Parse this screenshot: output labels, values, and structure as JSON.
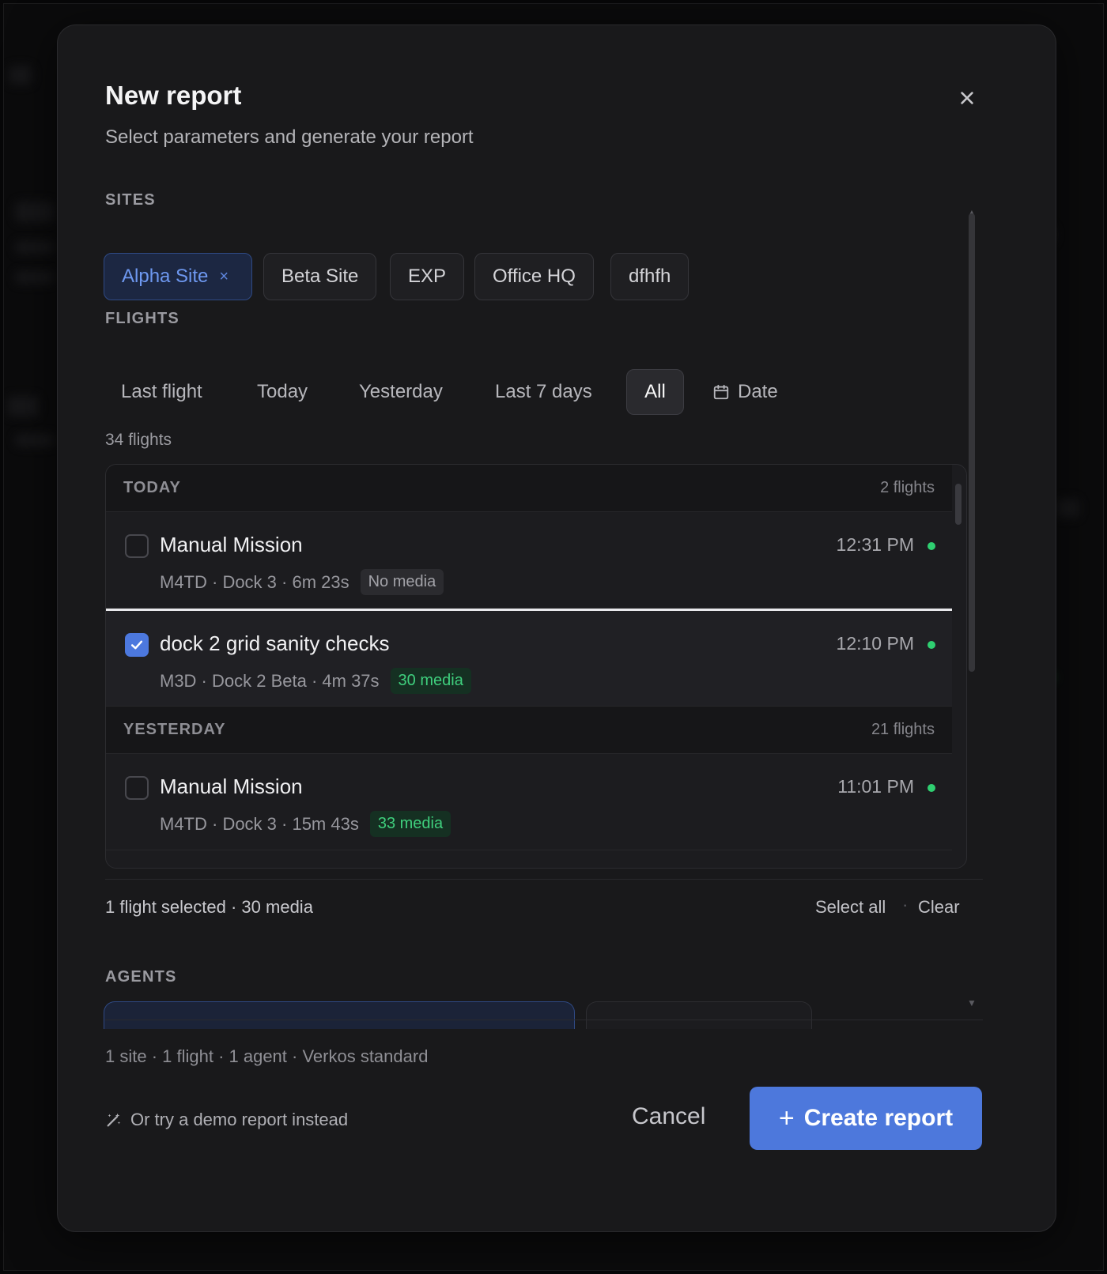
{
  "dialog": {
    "title": "New report",
    "subtitle": "Select parameters and generate your report",
    "close_icon": "close-icon"
  },
  "sites": {
    "label": "SITES",
    "items": [
      {
        "label": "Alpha Site",
        "selected": true,
        "remove_glyph": "×"
      },
      {
        "label": "Beta Site",
        "selected": false
      },
      {
        "label": "EXP",
        "selected": false
      },
      {
        "label": "Office HQ",
        "selected": false
      },
      {
        "label": "dfhfh",
        "selected": false
      }
    ]
  },
  "flights": {
    "label": "FLIGHTS",
    "filters": [
      {
        "label": "Last flight",
        "active": false
      },
      {
        "label": "Today",
        "active": false
      },
      {
        "label": "Yesterday",
        "active": false
      },
      {
        "label": "Last 7 days",
        "active": false
      },
      {
        "label": "All",
        "active": true
      },
      {
        "label": "Date",
        "active": false,
        "icon": "calendar-icon"
      }
    ],
    "count": "34 flights",
    "groups": [
      {
        "label": "TODAY",
        "count": "2 flights",
        "rows": [
          {
            "name": "Manual Mission",
            "meta": "M4TD · Dock 3 · 6m 23s",
            "badge": "No media",
            "badge_type": "gray",
            "time": "12:31 PM",
            "checked": false
          },
          {
            "name": "dock 2 grid sanity checks",
            "meta": "M3D · Dock 2 Beta · 4m 37s",
            "badge": "30 media",
            "badge_type": "green",
            "time": "12:10 PM",
            "checked": true
          }
        ]
      },
      {
        "label": "YESTERDAY",
        "count": "21 flights",
        "rows": [
          {
            "name": "Manual Mission",
            "meta": "M4TD · Dock 3 · 15m 43s",
            "badge": "33 media",
            "badge_type": "green",
            "time": "11:01 PM",
            "checked": false
          }
        ]
      }
    ],
    "selection_summary": "1 flight selected · 30 media",
    "select_all": "Select all",
    "separator": "·",
    "clear": "Clear"
  },
  "agents": {
    "label": "AGENTS"
  },
  "footer": {
    "summary": "1 site · 1 flight · 1 agent · Verkos standard",
    "demo_link": "Or try a demo report instead",
    "cancel": "Cancel",
    "create_plus": "+",
    "create": "Create report"
  },
  "colors": {
    "accent": "#4d78dc",
    "status_online": "#2fcf71",
    "background": "#19191b"
  }
}
